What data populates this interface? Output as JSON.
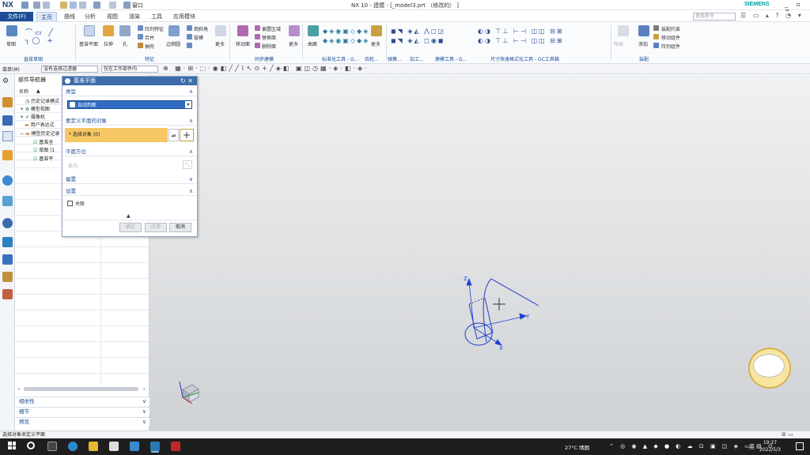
{
  "app": {
    "logo": "NX",
    "window_title": "NX 10 - 建模 - [_model3.prt （修改的） ]",
    "brand": "SIEMENS",
    "window_controls": "_ ▫ ✕",
    "search_placeholder": "查找命令"
  },
  "menu": {
    "file": "文件(F)",
    "tabs": [
      "主页",
      "曲线",
      "分析",
      "视图",
      "渲染",
      "工具",
      "应用模块"
    ],
    "active_tab": "主页",
    "window_menu": "窗口"
  },
  "ribbon": {
    "buttons": [
      "草图",
      "基准平面",
      "拉伸",
      "孔",
      "阵列特征",
      "合并",
      "抽壳",
      "边倒圆",
      "倒斜角",
      "拔模",
      "更多",
      "移动面",
      "偏置区域",
      "替换面",
      "删除面",
      "更多",
      "曲面",
      "更多",
      "布局",
      "添加",
      "装配约束",
      "移动组件",
      "阵列组件"
    ],
    "groups": [
      "直接草图",
      "特征",
      "同步建模",
      "标准化工具 - G...",
      "齿轮...",
      "弹簧...",
      "加工...",
      "建模工具 - G...",
      "尺寸快速格式化工具 - GC工具箱",
      "装配"
    ],
    "labels": {
      "sketch": "草图",
      "datum_plane": "基准平面",
      "extrude": "拉伸",
      "hole": "孔",
      "pattern": "阵列特征",
      "unite": "合并",
      "shell": "抽壳",
      "edge_blend": "边倒圆",
      "chamfer": "倒斜角",
      "draft": "拔模",
      "more1": "更多",
      "move_face": "移动面",
      "offset_region": "偏置区域",
      "replace_face": "替换面",
      "delete_face": "删除面",
      "more2": "更多",
      "surface": "曲面",
      "more3": "更多",
      "layout": "布局",
      "add": "添加",
      "assembly_constraints": "装配约束",
      "move_component": "移动组件",
      "pattern_component": "阵列组件",
      "g_direct_sketch": "直接草图",
      "g_feature": "特征",
      "g_sync": "同步建模",
      "g_std": "标准化工具 - G...",
      "g_gear": "齿轮...",
      "g_spring": "弹簧...",
      "g_machining": "加工...",
      "g_modeling": "建模工具 - G...",
      "g_dim": "尺寸快速格式化工具 - GC工具箱",
      "g_assembly": "装配"
    }
  },
  "toolbar2": {
    "menu": "菜单(M)",
    "filter": "没有选择过滤器",
    "scope": "仅在工作部件内"
  },
  "navigator": {
    "title": "部件导航器",
    "column_name": "名称",
    "nodes": [
      {
        "label": "历史记录模式"
      },
      {
        "label": "模型视图"
      },
      {
        "label": "摄像机"
      },
      {
        "label": "用户表达式"
      },
      {
        "label": "模型历史记录"
      },
      {
        "label": "基准坐"
      },
      {
        "label": "草图 (1"
      },
      {
        "label": "基准平"
      }
    ],
    "accordions": [
      "相依性",
      "细节",
      "预览"
    ]
  },
  "dialog": {
    "title": "基准平面",
    "section_type": "类型",
    "type_value": "自动判断",
    "section_objects": "要定义平面的对象",
    "objects_value": "* 选择对象 (0)",
    "section_orientation": "平面方位",
    "orientation_value": "反向",
    "section_offset": "偏置",
    "section_settings": "设置",
    "associative_label": "关联",
    "btn_ok": "确定",
    "btn_apply": "应用",
    "btn_cancel": "取消"
  },
  "status": {
    "prompt": "选择对象来定义平面"
  },
  "taskbar": {
    "weather": "27°C 晴朗",
    "ime": "英",
    "time": "19:27",
    "date": "2022/5/3"
  },
  "colors": {
    "accent": "#1c4e96",
    "dialog_title": "#3d6cab",
    "selection_row": "#f6c764",
    "model_lines": "#1f3fd0"
  }
}
